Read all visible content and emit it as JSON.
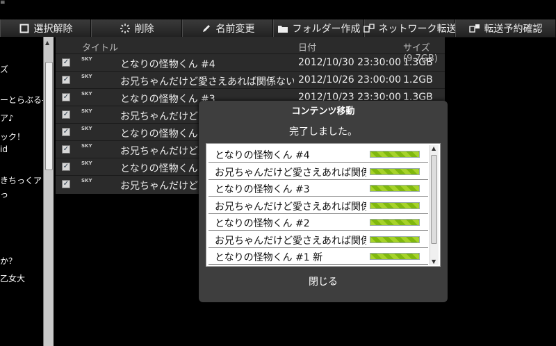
{
  "toolbar": {
    "items": [
      {
        "label": "選択解除",
        "icon": "square-icon"
      },
      {
        "label": "削除",
        "icon": "spinner-icon"
      },
      {
        "label": "名前変更",
        "icon": "pencil-icon"
      },
      {
        "label": "フォルダー作成",
        "icon": "folder-icon"
      },
      {
        "label": "ネットワーク転送",
        "icon": "network-transfer-icon"
      },
      {
        "label": "転送予約確認",
        "icon": "transfer-reservation-icon"
      }
    ]
  },
  "sidebar": {
    "lines": [
      "ズ",
      "ーとらぶる-",
      "ア♪",
      "ック！",
      "id",
      "きちっくア",
      "っ",
      "か？",
      "乙女大"
    ]
  },
  "filelist": {
    "headers": {
      "title": "タイトル",
      "date": "日付",
      "size": "サイズ (9.7GB)"
    },
    "channel_logo": "SKY",
    "rows": [
      {
        "title": "となりの怪物くん #4",
        "date": "2012/10/30 23:30:00",
        "size": "1.3GB"
      },
      {
        "title": "お兄ちゃんだけど愛さえあれば関係ないよ",
        "date": "2012/10/26 23:00:00",
        "size": "1.2GB"
      },
      {
        "title": "となりの怪物くん #3",
        "date": "2012/10/23 23:30:00",
        "size": "1.3GB"
      },
      {
        "title": "お兄ちゃんだけど愛さえあれば関係ないよ",
        "date": "",
        "size": ""
      },
      {
        "title": "となりの怪物くん #2",
        "date": "",
        "size": ""
      },
      {
        "title": "お兄ちゃんだけど愛さえあれば関係ないよ",
        "date": "",
        "size": ""
      },
      {
        "title": "となりの怪物くん #1",
        "date": "",
        "size": ""
      },
      {
        "title": "お兄ちゃんだけど愛さえあれば関係ないよ",
        "date": "",
        "size": ""
      }
    ]
  },
  "dialog": {
    "title": "コンテンツ移動",
    "message": "完了しました。",
    "items": [
      {
        "name": "となりの怪物くん #4",
        "progress": 1.0
      },
      {
        "name": "お兄ちゃんだけど愛さえあれば関係ないよ",
        "progress": 1.0
      },
      {
        "name": "となりの怪物くん #3",
        "progress": 1.0
      },
      {
        "name": "お兄ちゃんだけど愛さえあれば関係ないよ",
        "progress": 1.0
      },
      {
        "name": "となりの怪物くん #2",
        "progress": 1.0
      },
      {
        "name": "お兄ちゃんだけど愛さえあれば関係ないよ",
        "progress": 1.0
      },
      {
        "name": "となりの怪物くん #1 新",
        "progress": 1.0
      }
    ],
    "close_label": "閉じる"
  }
}
